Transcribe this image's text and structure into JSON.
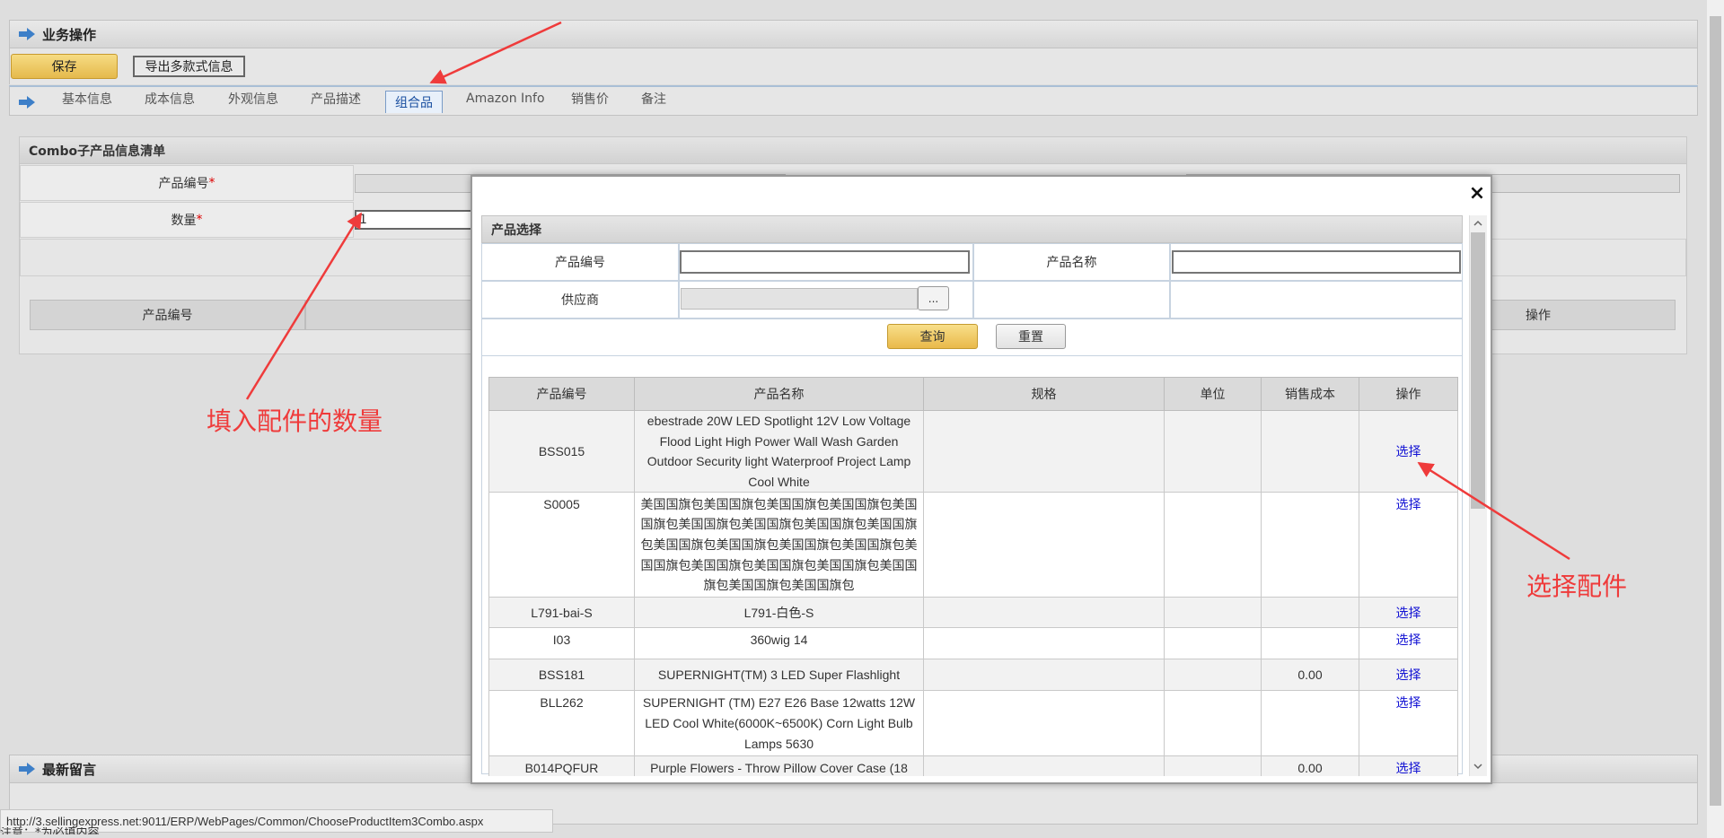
{
  "panel": {
    "title": "业务操作"
  },
  "toolbar": {
    "save_label": "保存",
    "export_label": "导出多款式信息"
  },
  "tabs": [
    "基本信息",
    "成本信息",
    "外观信息",
    "产品描述",
    "组合品",
    "Amazon Info",
    "销售价",
    "备注"
  ],
  "combo": {
    "title": "Combo子产品信息清单",
    "product_code_label": "产品编号",
    "quantity_label": "数量",
    "required_mark": "*",
    "quantity_value": "1",
    "grid_col_code": "产品编号",
    "grid_col_action": "操作"
  },
  "messages": {
    "title": "最新留言"
  },
  "annotations": {
    "quantity_hint": "填入配件的数量",
    "select_hint": "选择配件"
  },
  "modal": {
    "close": "×",
    "title": "产品选择",
    "search": {
      "code_label": "产品编号",
      "name_label": "产品名称",
      "supplier_label": "供应商",
      "dots": "...",
      "code_value": "",
      "name_value": ""
    },
    "query_button": "查询",
    "reset_button": "重置",
    "table": {
      "headers": [
        "产品编号",
        "产品名称",
        "规格",
        "单位",
        "销售成本",
        "操作"
      ],
      "rows": [
        {
          "code": "BSS015",
          "name": "ebestrade 20W LED Spotlight 12V Low Voltage Flood Light High Power Wall Wash Garden Outdoor Security light Waterproof Project Lamp Cool White",
          "spec": "",
          "unit": "",
          "cost": "",
          "action": "选择"
        },
        {
          "code": "S0005",
          "name": "美国国旗包美国国旗包美国国旗包美国国旗包美国国旗包美国国旗包美国国旗包美国国旗包美国国旗包美国国旗包美国国旗包美国国旗包美国国旗包美国国旗包美国国旗包美国国旗包美国国旗包美国国旗包美国国旗包美国国旗包",
          "spec": "",
          "unit": "",
          "cost": "",
          "action": "选择"
        },
        {
          "code": "L791-bai-S",
          "name": "L791-白色-S",
          "spec": "",
          "unit": "",
          "cost": "",
          "action": "选择"
        },
        {
          "code": "I03",
          "name": "360wig 14",
          "spec": "",
          "unit": "",
          "cost": "",
          "action": "选择"
        },
        {
          "code": "BSS181",
          "name": "SUPERNIGHT(TM) 3 LED Super Flashlight",
          "spec": "",
          "unit": "",
          "cost": "0.00",
          "action": "选择"
        },
        {
          "code": "BLL262",
          "name": "SUPERNIGHT (TM) E27 E26 Base 12watts 12W LED Cool White(6000K~6500K) Corn Light Bulb Lamps 5630",
          "spec": "",
          "unit": "",
          "cost": "",
          "action": "选择"
        },
        {
          "code": "B014PQFUR",
          "name": "Purple Flowers - Throw Pillow Cover Case (18",
          "spec": "",
          "unit": "",
          "cost": "0.00",
          "action": "选择"
        }
      ]
    }
  },
  "status": {
    "url": "http://3.sellingexpress.net:9011/ERP/WebPages/Common/ChooseProductItem3Combo.aspx",
    "note": "注意：*为必填内容"
  },
  "colors": {
    "accent": "#1a4fa0",
    "link": "#1414d4",
    "annotation": "#ef3b3b",
    "save_button": "#e5b94c"
  }
}
